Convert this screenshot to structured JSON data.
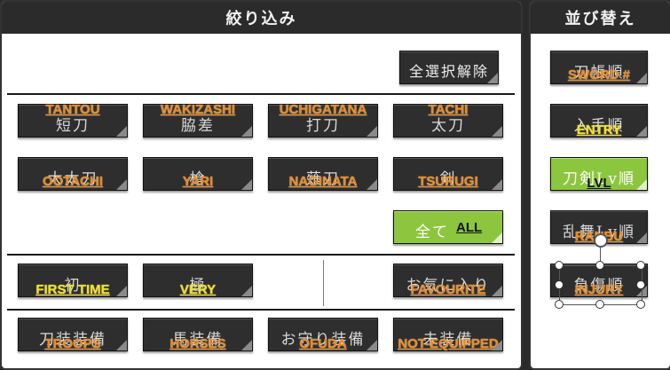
{
  "filter": {
    "title": "絞り込み",
    "deselect_all": "全選択解除",
    "types": [
      {
        "jp": "短刀",
        "en": "TANTOU"
      },
      {
        "jp": "脇差",
        "en": "WAKIZASHI"
      },
      {
        "jp": "打刀",
        "en": "UCHIGATANA"
      },
      {
        "jp": "太刀",
        "en": "TACHI"
      },
      {
        "jp": "大太刀",
        "en": "OOTACHI"
      },
      {
        "jp": "槍",
        "en": "YARI"
      },
      {
        "jp": "薙刀",
        "en": "NAGINATA"
      },
      {
        "jp": "剣",
        "en": "TSURUGI"
      }
    ],
    "all": {
      "jp": "全て",
      "en": "ALL"
    },
    "rank": [
      {
        "jp": "初",
        "en": "FIRST TIME"
      },
      {
        "jp": "極",
        "en": "VERY"
      }
    ],
    "favourite": {
      "jp": "お気に入り",
      "en": "FAVOURITE"
    },
    "equip": [
      {
        "jp": "刀装装備",
        "en": "TROOPS"
      },
      {
        "jp": "馬装備",
        "en": "HORSES"
      },
      {
        "jp": "お守り装備",
        "en": "OFUDA"
      },
      {
        "jp": "未装備",
        "en": "NOT-EQUIPPED"
      }
    ]
  },
  "sort": {
    "title": "並び替え",
    "items": [
      {
        "jp": "刀帳順",
        "en": "SWORD #"
      },
      {
        "jp": "入手順",
        "en": "ENTRY"
      },
      {
        "jp": "刀剣Lv順",
        "en": "LVL"
      },
      {
        "jp": "乱舞Lv順",
        "en": "RANBU"
      },
      {
        "jp": "負傷順",
        "en": "INJURY"
      }
    ]
  },
  "colors": {
    "accent_green": "#8cc63e",
    "label_orange": "#f08a1c",
    "label_yellow": "#f4e21a"
  }
}
